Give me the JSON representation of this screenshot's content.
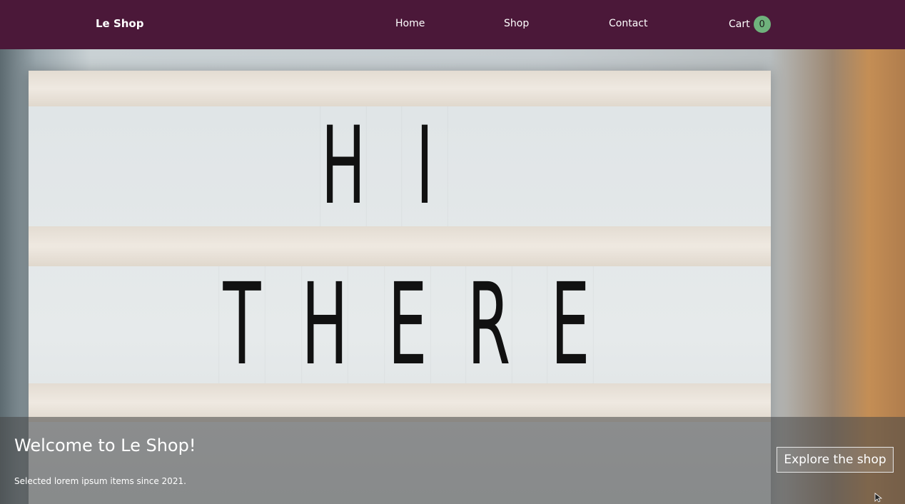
{
  "navbar": {
    "brand": "Le Shop",
    "links": [
      {
        "label": "Home"
      },
      {
        "label": "Shop"
      },
      {
        "label": "Contact"
      }
    ],
    "cart": {
      "label": "Cart",
      "count": "0"
    }
  },
  "hero": {
    "sign": {
      "line1": [
        "H",
        "I"
      ],
      "line2": [
        "T",
        "H",
        "E",
        "R",
        "E"
      ]
    },
    "title": "Welcome to Le Shop!",
    "subtitle": "Selected lorem ipsum items since 2021.",
    "cta_label": "Explore the shop"
  },
  "colors": {
    "navbar_bg": "#4b1839",
    "cart_badge": "#6fb27c",
    "overlay": "rgba(70,70,70,0.55)"
  }
}
